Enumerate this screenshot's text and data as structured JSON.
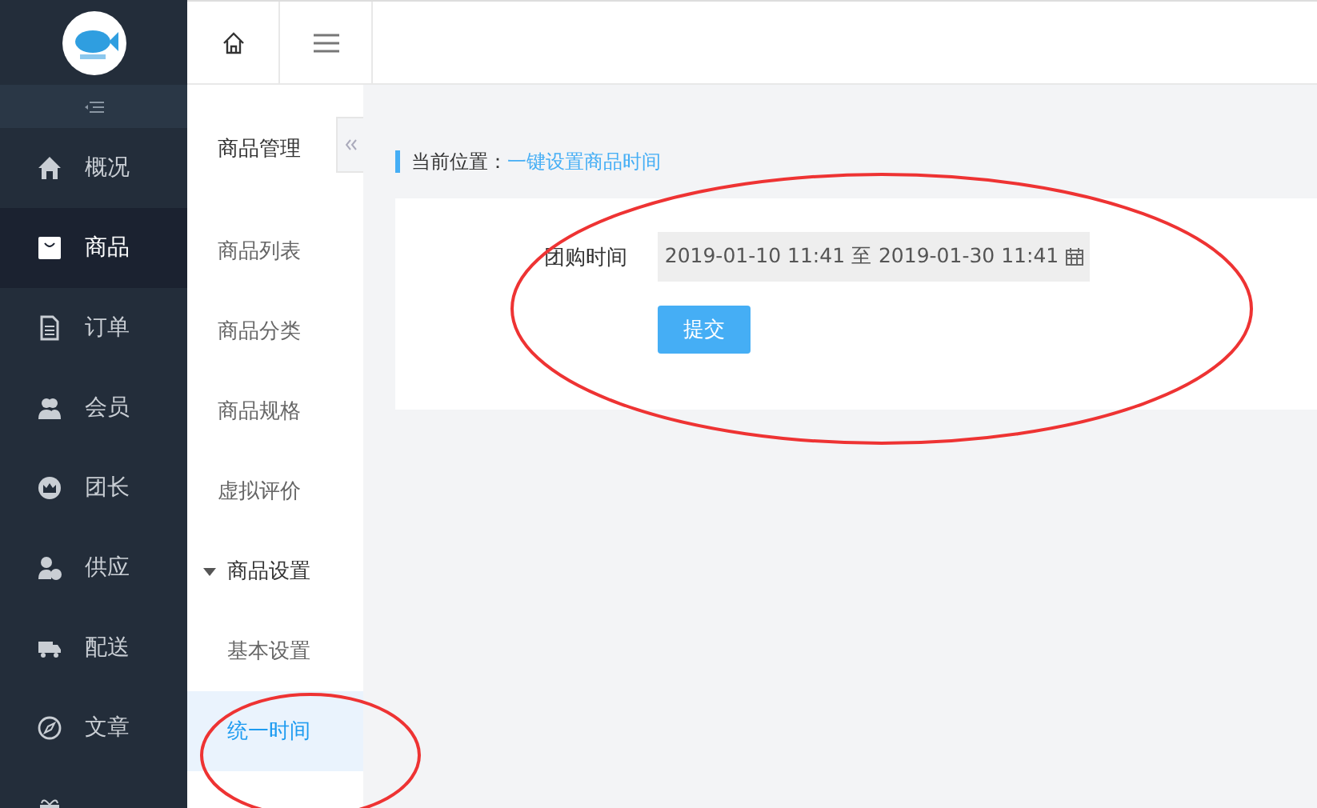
{
  "sidebar": {
    "items": [
      {
        "label": "概况",
        "selected": false
      },
      {
        "label": "商品",
        "selected": true
      },
      {
        "label": "订单",
        "selected": false
      },
      {
        "label": "会员",
        "selected": false
      },
      {
        "label": "团长",
        "selected": false
      },
      {
        "label": "供应",
        "selected": false
      },
      {
        "label": "配送",
        "selected": false
      },
      {
        "label": "文章",
        "selected": false
      },
      {
        "selected": false
      }
    ]
  },
  "submenu": {
    "title": "商品管理",
    "items": [
      {
        "label": "商品列表",
        "kind": "link",
        "selected": false
      },
      {
        "label": "商品分类",
        "kind": "link",
        "selected": false
      },
      {
        "label": "商品规格",
        "kind": "link",
        "selected": false
      },
      {
        "label": "虚拟评价",
        "kind": "link",
        "selected": false
      },
      {
        "label": "商品设置",
        "kind": "group",
        "expanded": true,
        "children": [
          {
            "label": "基本设置",
            "kind": "link",
            "selected": false
          },
          {
            "label": "统一时间",
            "kind": "link",
            "selected": true
          }
        ]
      }
    ]
  },
  "breadcrumb": {
    "prefix": "当前位置：",
    "current": "一键设置商品时间"
  },
  "form": {
    "label": "团购时间",
    "value": "2019-01-10 11:41 至 2019-01-30 11:41",
    "submit": "提交"
  }
}
